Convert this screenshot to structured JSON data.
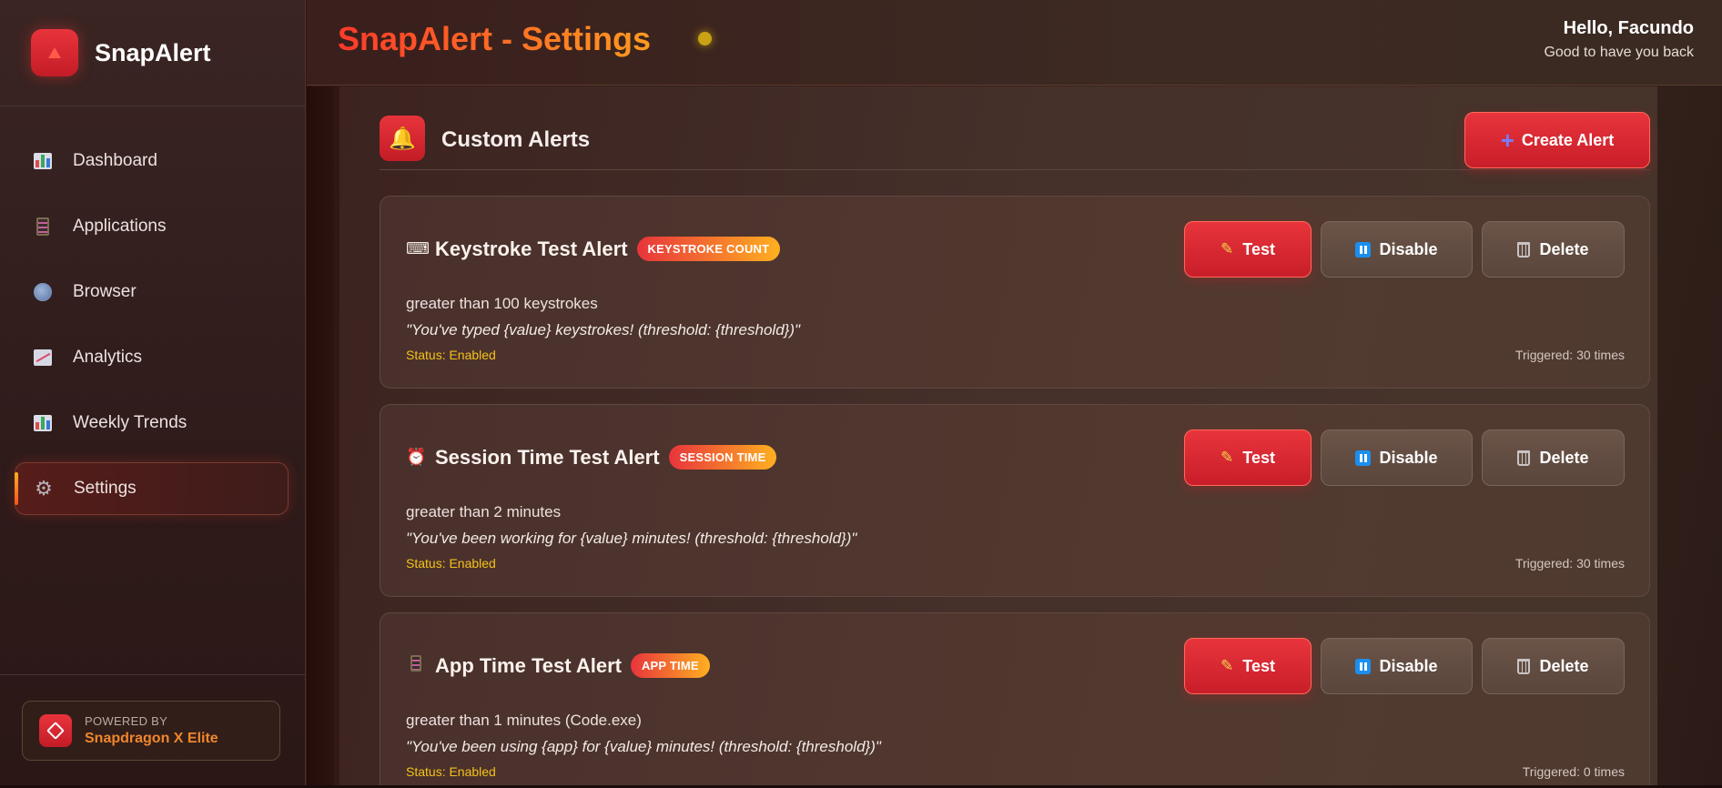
{
  "app": {
    "name": "SnapAlert",
    "title": "SnapAlert - Settings",
    "greeting": "Hello, Facundo",
    "greeting_sub": "Good to have you back"
  },
  "sidebar": {
    "items": [
      {
        "label": "Dashboard",
        "icon": "bar-chart-icon"
      },
      {
        "label": "Applications",
        "icon": "abacus-icon"
      },
      {
        "label": "Browser",
        "icon": "globe-icon"
      },
      {
        "label": "Analytics",
        "icon": "trend-chart-icon"
      },
      {
        "label": "Weekly Trends",
        "icon": "bar-chart-icon"
      },
      {
        "label": "Settings",
        "icon": "gear-icon",
        "active": true
      }
    ],
    "footer": {
      "powered_by": "POWERED BY",
      "chip": "Snapdragon X Elite"
    }
  },
  "section": {
    "title": "Custom Alerts",
    "icon": "bell-icon",
    "create_label": "Create Alert"
  },
  "alerts": [
    {
      "icon": "keyboard-icon",
      "name": "Keystroke Test Alert",
      "badge": "KEYSTROKE COUNT",
      "condition": "greater than 100 keystrokes",
      "message": "\"You've typed {value} keystrokes! (threshold: {threshold})\"",
      "status": "Status: Enabled",
      "triggered": "Triggered: 30 times"
    },
    {
      "icon": "alarm-clock-icon",
      "name": "Session Time Test Alert",
      "badge": "SESSION TIME",
      "condition": "greater than 2 minutes",
      "message": "\"You've been working for {value} minutes! (threshold: {threshold})\"",
      "status": "Status: Enabled",
      "triggered": "Triggered: 30 times"
    },
    {
      "icon": "abacus-icon",
      "name": "App Time Test Alert",
      "badge": "APP TIME",
      "condition": "greater than 1 minutes (Code.exe)",
      "message": "\"You've been using {app} for {value} minutes! (threshold: {threshold})\"",
      "status": "Status: Enabled",
      "triggered": "Triggered: 0 times"
    }
  ],
  "actions": {
    "test": "Test",
    "disable": "Disable",
    "delete": "Delete"
  },
  "colors": {
    "accent_red": "#e8343c",
    "accent_orange": "#ff9b20",
    "status_yellow": "#f4c21a",
    "pause_blue": "#1a8ff0"
  }
}
